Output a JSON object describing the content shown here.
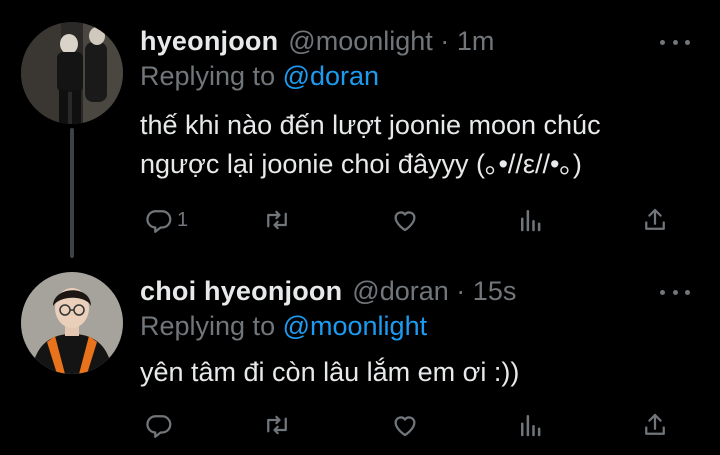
{
  "tweets": [
    {
      "name": "hyeonjoon",
      "handle": "@moonlight",
      "separator": "·",
      "time": "1m",
      "replying_prefix": "Replying to",
      "replying_to": "@doran",
      "lines": [
        "thế khi nào đến lượt joonie moon chúc",
        "ngược lại joonie choi đâyyy (｡•//ε//•｡)"
      ],
      "reply_count": "1"
    },
    {
      "name": "choi hyeonjoon",
      "handle": "@doran",
      "separator": "·",
      "time": "15s",
      "replying_prefix": "Replying to",
      "replying_to": "@moonlight",
      "lines": [
        "yên tâm đi còn lâu lắm em ơi :))"
      ],
      "reply_count": ""
    }
  ],
  "icons": {
    "reply": "reply-icon",
    "retweet": "retweet-icon",
    "like": "like-icon",
    "views": "views-icon",
    "share": "share-icon",
    "more": "more-icon"
  },
  "colors": {
    "background": "#000000",
    "text": "#e7e9ea",
    "muted": "#71767b",
    "accent": "#1d9bf0",
    "thread_line": "#3d4145"
  }
}
